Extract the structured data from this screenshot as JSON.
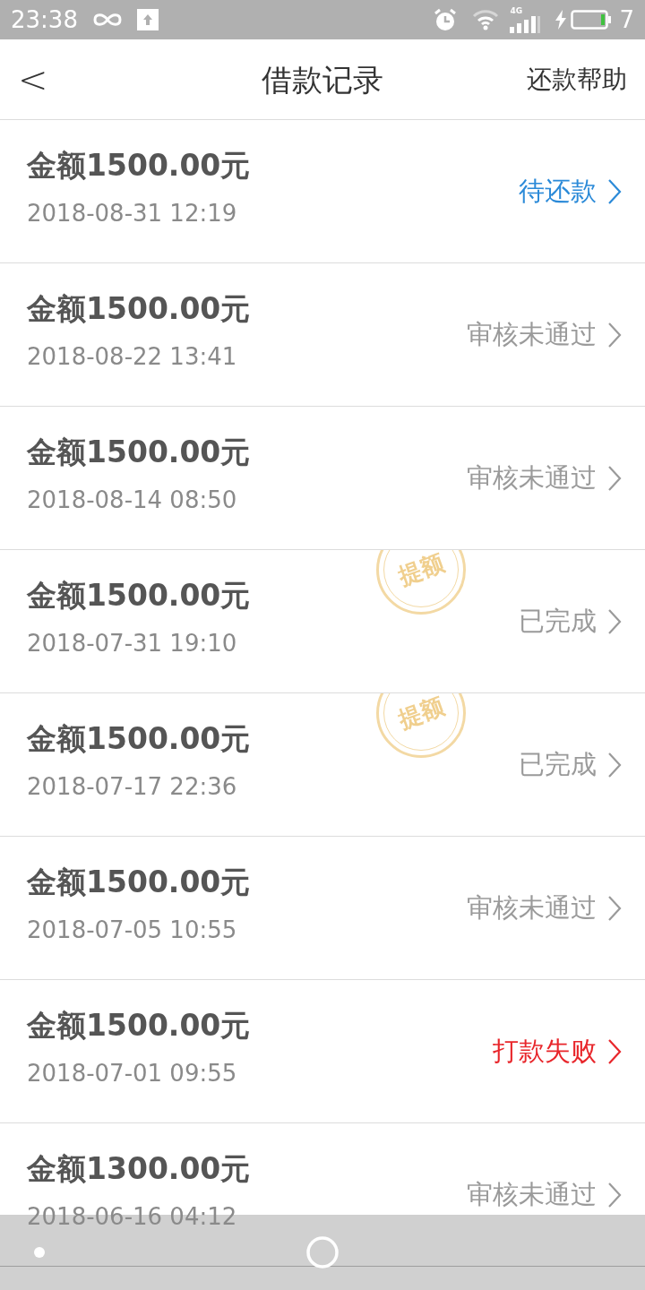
{
  "status_bar": {
    "time": "23:38",
    "network": "4G",
    "battery": "7"
  },
  "header": {
    "back": "<",
    "title": "借款记录",
    "action": "还款帮助"
  },
  "records": [
    {
      "amount": "金额1500.00元",
      "date": "2018-08-31 12:19",
      "status": "待还款",
      "kind": "pending"
    },
    {
      "amount": "金额1500.00元",
      "date": "2018-08-22 13:41",
      "status": "审核未通过",
      "kind": "rejected"
    },
    {
      "amount": "金额1500.00元",
      "date": "2018-08-14 08:50",
      "status": "审核未通过",
      "kind": "rejected"
    },
    {
      "amount": "金额1500.00元",
      "date": "2018-07-31 19:10",
      "status": "已完成",
      "kind": "done",
      "stamp": "提额"
    },
    {
      "amount": "金额1500.00元",
      "date": "2018-07-17 22:36",
      "status": "已完成",
      "kind": "done",
      "stamp": "提额"
    },
    {
      "amount": "金额1500.00元",
      "date": "2018-07-05 10:55",
      "status": "审核未通过",
      "kind": "rejected"
    },
    {
      "amount": "金额1500.00元",
      "date": "2018-07-01 09:55",
      "status": "打款失败",
      "kind": "failed"
    },
    {
      "amount": "金额1300.00元",
      "date": "2018-06-16 04:12",
      "status": "审核未通过",
      "kind": "rejected"
    }
  ]
}
